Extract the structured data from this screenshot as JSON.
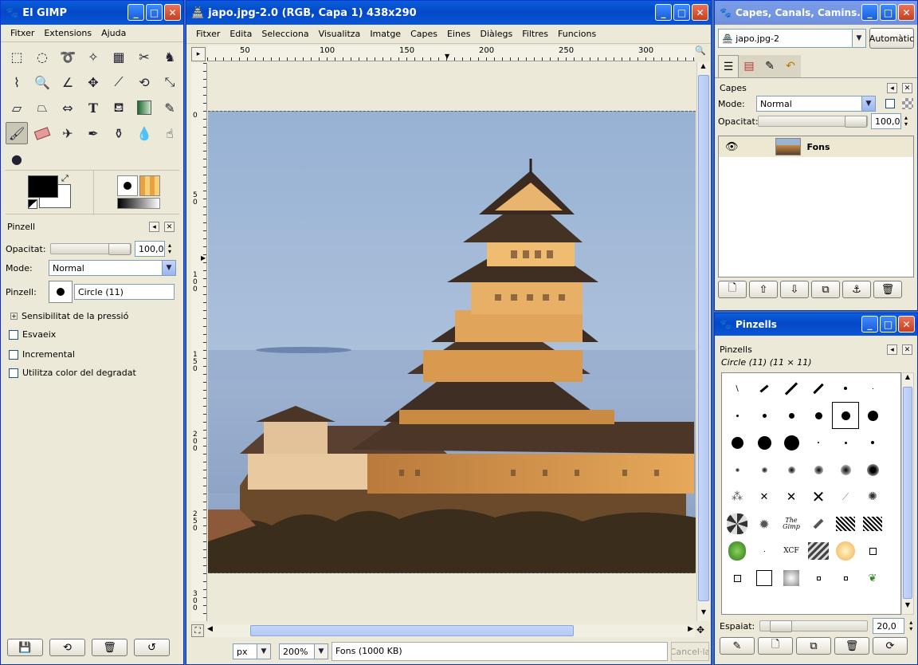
{
  "toolbox": {
    "title": "El GIMP",
    "menu": [
      "Fitxer",
      "Extensions",
      "Ajuda"
    ],
    "tools": [
      "rect-select",
      "ellipse-select",
      "free-select",
      "fuzzy-select",
      "color-select",
      "scissors",
      "foreground-select",
      "color-picker",
      "zoom",
      "measure",
      "move",
      "crop",
      "rotate",
      "scale",
      "shear",
      "perspective",
      "flip",
      "text",
      "bucket-fill",
      "blend",
      "pencil",
      "paintbrush",
      "eraser",
      "airbrush",
      "ink",
      "clone",
      "heal",
      "smudge",
      "dodge-burn"
    ],
    "tool_options": {
      "title": "Pinzell",
      "opacity_label": "Opacitat:",
      "opacity_value": "100,0",
      "mode_label": "Mode:",
      "mode_value": "Normal",
      "brush_label": "Pinzell:",
      "brush_value": "Circle (11)",
      "pressure_label": "Sensibilitat de la pressió",
      "fade_label": "Esvaeix",
      "incremental_label": "Incremental",
      "gradient_label": "Utilitza color del degradat"
    }
  },
  "image_window": {
    "title": "japo.jpg-2.0 (RGB, Capa 1) 438x290",
    "menu": [
      "Fitxer",
      "Edita",
      "Selecciona",
      "Visualitza",
      "Imatge",
      "Capes",
      "Eines",
      "Diàlegs",
      "Filtres",
      "Funcions"
    ],
    "ruler_h": [
      "50",
      "100",
      "150",
      "200",
      "250",
      "300"
    ],
    "ruler_v": [
      "0",
      "5\n0",
      "1\n0\n0",
      "1\n5\n0",
      "2\n0\n0",
      "2\n5\n0",
      "3\n0\n0"
    ],
    "unit": "px",
    "zoom": "200%",
    "status": "Fons (1000 KB)",
    "cancel": "Cancel·la"
  },
  "layers_dock": {
    "title": "Capes, Canals, Camins...",
    "image_select": "japo.jpg-2",
    "auto_button": "Automàtic",
    "panel_title": "Capes",
    "mode_label": "Mode:",
    "mode_value": "Normal",
    "opacity_label": "Opacitat:",
    "opacity_value": "100,0",
    "layer_name": "Fons"
  },
  "brushes_dock": {
    "title": "Pinzells",
    "panel_title": "Pinzells",
    "current": "Circle (11) (11 × 11)",
    "spacing_label": "Espaiat:",
    "spacing_value": "20,0",
    "brush_texts": [
      "The Gimp",
      "XCF"
    ]
  },
  "colors": {
    "xp_blue": "#0a5fd9",
    "dialog_bg": "#ece9d8",
    "sky": "#a8bcd8",
    "castle": "#d89a50"
  }
}
